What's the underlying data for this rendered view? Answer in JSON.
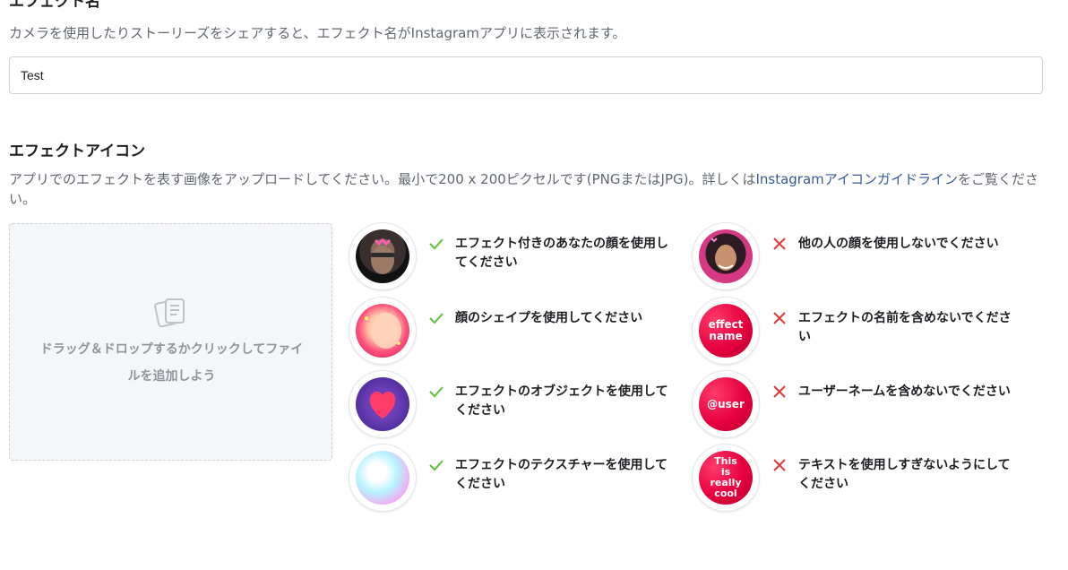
{
  "effect_name": {
    "title": "エフェクト名",
    "description": "カメラを使用したりストーリーズをシェアすると、エフェクト名がInstagramアプリに表示されます。",
    "value": "Test"
  },
  "effect_icon": {
    "title": "エフェクトアイコン",
    "description_part1": "アプリでのエフェクトを表す画像をアップロードしてください。最小で200 x 200ピクセルです(PNGまたはJPG)。詳しくは",
    "description_link": "Instagramアイコンガイドライン",
    "description_part2": "をご覧ください。",
    "dropzone_line1": "ドラッグ＆ドロップするかクリックしてファイ",
    "dropzone_line2": "ルを追加しよう",
    "icons": {
      "files": "files-icon",
      "check": "check-icon",
      "cross": "cross-icon"
    },
    "do_guides": [
      {
        "text": "エフェクト付きのあなたの顔を使用してください",
        "image": "user-face-with-effect-icon"
      },
      {
        "text": "顔のシェイプを使用してください",
        "image": "face-shape-icon"
      },
      {
        "text": "エフェクトのオブジェクトを使用してください",
        "image": "heart-object-icon"
      },
      {
        "text": "エフェクトのテクスチャーを使用してください",
        "image": "texture-icon"
      }
    ],
    "dont_guides": [
      {
        "text": "他の人の顔を使用しないでください",
        "image": "other-person-face-icon"
      },
      {
        "text": "エフェクトの名前を含めないでください",
        "image_text": "effect name"
      },
      {
        "text": "ユーザーネームを含めないでください",
        "image_text": "@user"
      },
      {
        "text": "テキストを使用しすぎないようにしてください",
        "image_text": "This is really cool"
      }
    ],
    "colors": {
      "check": "#5fbf3b",
      "cross": "#e0393e",
      "link": "#385898"
    }
  }
}
